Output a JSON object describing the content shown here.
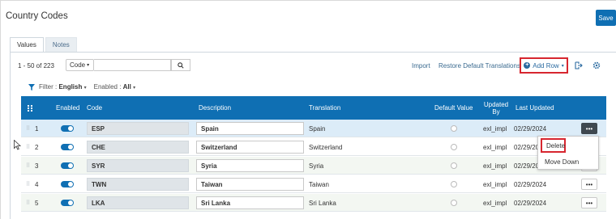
{
  "page": {
    "title": "Country Codes",
    "save_label": "Save"
  },
  "tabs": [
    {
      "label": "Values"
    },
    {
      "label": "Notes"
    }
  ],
  "toolbar": {
    "count_text": "1 - 50 of 223",
    "code_select": "Code",
    "search_value": "",
    "import_label": "Import",
    "restore_label": "Restore Default Translations",
    "add_row_label": "Add Row"
  },
  "filter": {
    "filter_prefix": "Filter :",
    "filter_value": "English",
    "enabled_prefix": "Enabled :",
    "enabled_value": "All"
  },
  "table": {
    "headers": {
      "enabled": "Enabled",
      "code": "Code",
      "description": "Description",
      "translation": "Translation",
      "default_value": "Default Value",
      "updated_by": "Updated By",
      "last_updated": "Last Updated"
    },
    "rows": [
      {
        "num": "1",
        "code": "ESP",
        "description": "Spain",
        "translation": "Spain",
        "updated_by": "exl_impl",
        "last_updated": "02/29/2024"
      },
      {
        "num": "2",
        "code": "CHE",
        "description": "Switzerland",
        "translation": "Switzerland",
        "updated_by": "exl_impl",
        "last_updated": "02/29/20"
      },
      {
        "num": "3",
        "code": "SYR",
        "description": "Syria",
        "translation": "Syria",
        "updated_by": "exl_impl",
        "last_updated": "02/29/20"
      },
      {
        "num": "4",
        "code": "TWN",
        "description": "Taiwan",
        "translation": "Taiwan",
        "updated_by": "exl_impl",
        "last_updated": "02/29/2024"
      },
      {
        "num": "5",
        "code": "LKA",
        "description": "Sri Lanka",
        "translation": "Sri Lanka",
        "updated_by": "exl_impl",
        "last_updated": "02/29/2024"
      }
    ]
  },
  "context_menu": {
    "delete_label": "Delete",
    "move_down_label": "Move Down"
  },
  "colors": {
    "primary": "#0f6fb3",
    "highlight_border": "#d7262f",
    "selected_row": "#dcecf8"
  }
}
